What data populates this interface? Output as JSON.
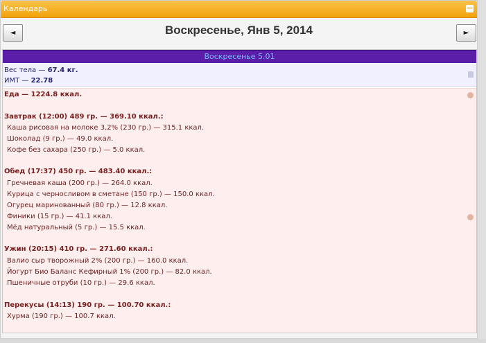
{
  "widget": {
    "title": "Календарь",
    "minimize_icon": "minus-icon"
  },
  "nav": {
    "prev_icon": "◄",
    "next_icon": "►",
    "date_title": "Воскресенье, Янв 5, 2014"
  },
  "day": {
    "header": "Воскресенье 5.01",
    "weight_label": "Вес тела —",
    "weight_value": "67.4 кг.",
    "bmi_label": "ИМТ —",
    "bmi_value": "22.78"
  },
  "food": {
    "total": "Еда — 1224.8 ккал.",
    "meals": [
      {
        "title": "Завтрак (12:00) 489 гр. — 369.10 ккал.:",
        "items": [
          "Каша рисовая на молоке 3,2% (230 гр.) — 315.1 ккал.",
          "Шоколад (9 гр.) — 49.0 ккал.",
          "Кофе без сахара (250 гр.) — 5.0 ккал."
        ]
      },
      {
        "title": "Обед (17:37) 450 гр. — 483.40 ккал.:",
        "items": [
          "Гречневая каша (200 гр.) — 264.0 ккал.",
          "Курица с черносливом в сметане (150 гр.) — 150.0 ккал.",
          "Огурец маринованный (80 гр.) — 12.8 ккал.",
          "Финики (15 гр.) — 41.1 ккал.",
          "Мёд натуральный (5 гр.) — 15.5 ккал."
        ]
      },
      {
        "title": "Ужин (20:15) 410 гр. — 271.60 ккал.:",
        "items": [
          "Валио сыр творожный 2% (200 гр.) — 160.0 ккал.",
          "Йогурт Био Баланс Кефирный 1% (200 гр.) — 82.0 ккал.",
          "Пшеничные отруби (10 гр.) — 29.6 ккал."
        ]
      },
      {
        "title": "Перекусы (14:13) 190 гр. — 100.70 ккал.:",
        "items": [
          "Хурма (190 гр.) — 100.7 ккал."
        ]
      }
    ]
  }
}
